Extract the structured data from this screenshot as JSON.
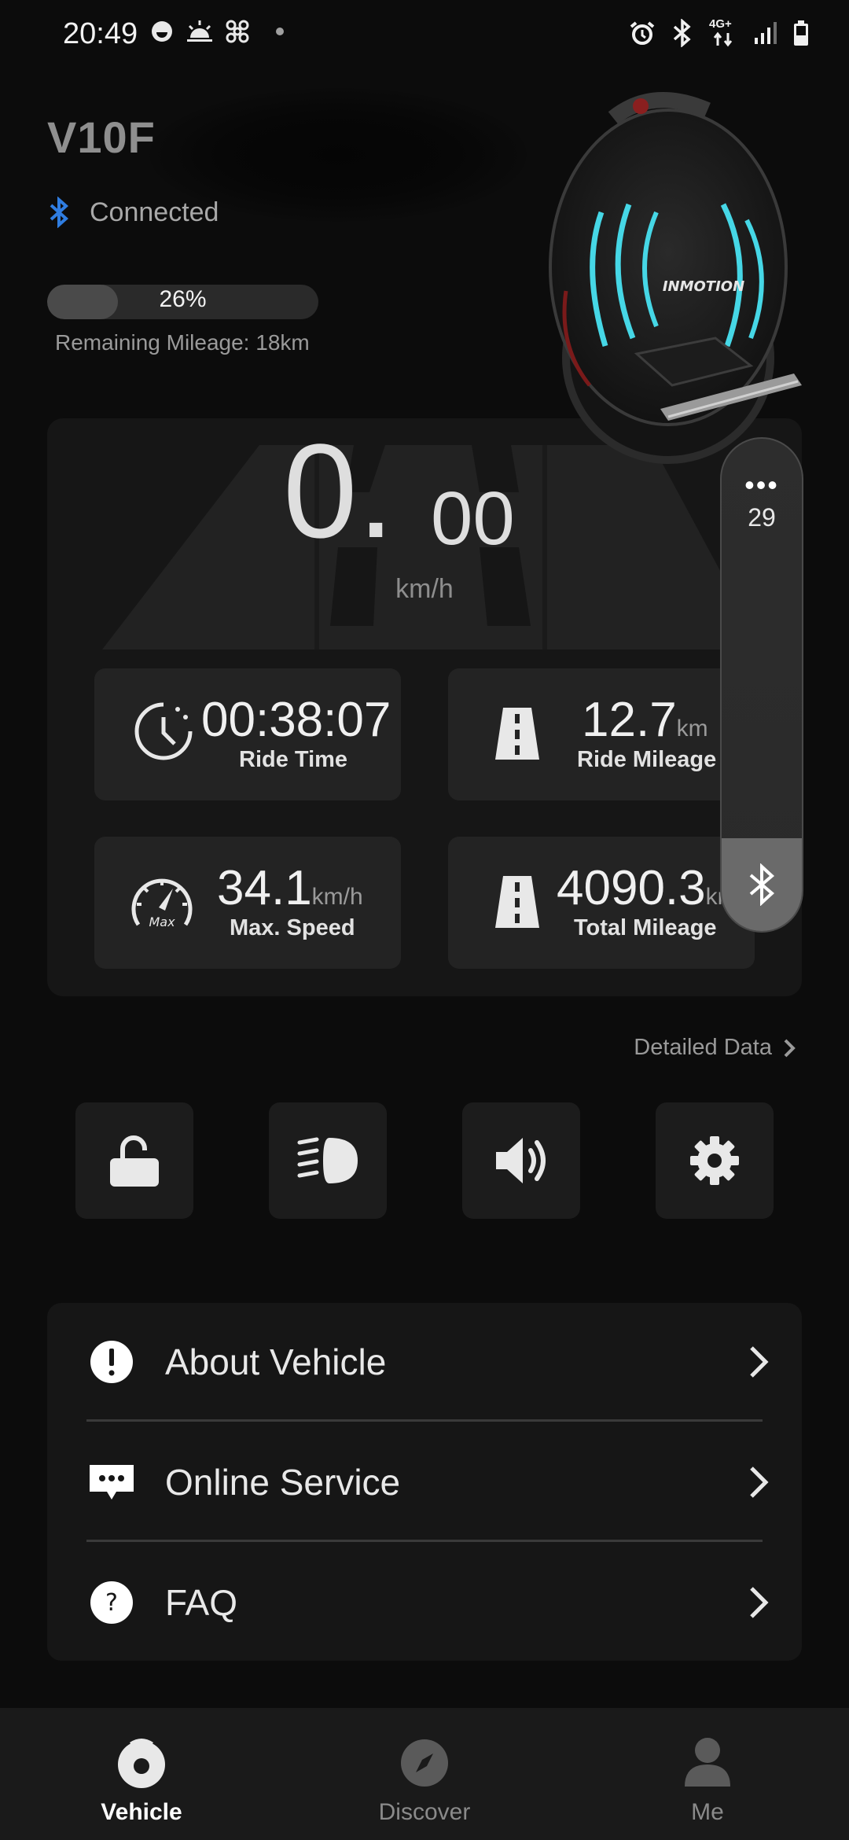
{
  "status_bar": {
    "time": "20:49",
    "network": "4G+",
    "left_icons": [
      "face-icon",
      "sunrise-icon",
      "fan-icon",
      "dot-icon"
    ],
    "right_icons": [
      "alarm-icon",
      "bluetooth-icon",
      "network-4g-icon",
      "signal-icon",
      "battery-icon"
    ]
  },
  "header": {
    "vehicle_name": "V10F",
    "connection_status": "Connected",
    "battery_percent_label": "26%",
    "battery_level": 0.26,
    "remaining_mileage": "Remaining Mileage: 18km",
    "product_logo": "INMOTION"
  },
  "speed": {
    "integer": "0.",
    "decimal": "00",
    "unit": "km/h"
  },
  "stats": {
    "ride_time": {
      "value": "00:38:07",
      "unit": "",
      "label": "Ride Time"
    },
    "ride_mileage": {
      "value": "12.7",
      "unit": "km",
      "label": "Ride Mileage"
    },
    "max_speed": {
      "value": "34.1",
      "unit": "km/h",
      "label": "Max. Speed",
      "icon_text": "Max"
    },
    "total_mileage": {
      "value": "4090.3",
      "unit": "km",
      "label": "Total Mileage"
    }
  },
  "side_panel": {
    "more": "•••",
    "count": "29"
  },
  "detailed_data_link": "Detailed Data",
  "quick_actions": [
    "lock-open-icon",
    "headlight-icon",
    "volume-icon",
    "settings-icon"
  ],
  "menu": {
    "items": [
      {
        "label": "About Vehicle",
        "icon": "info-icon"
      },
      {
        "label": "Online Service",
        "icon": "chat-icon"
      },
      {
        "label": "FAQ",
        "icon": "help-icon"
      }
    ]
  },
  "bottom_nav": {
    "items": [
      {
        "label": "Vehicle",
        "active": true
      },
      {
        "label": "Discover",
        "active": false
      },
      {
        "label": "Me",
        "active": false
      }
    ]
  },
  "colors": {
    "background": "#0c0c0c",
    "card": "#161616",
    "tile": "#232323",
    "bluetooth_blue": "#2f7de1",
    "accent_cyan": "#46d7e6",
    "text_primary": "#e8e8e8",
    "text_secondary": "#9a9a9a"
  }
}
